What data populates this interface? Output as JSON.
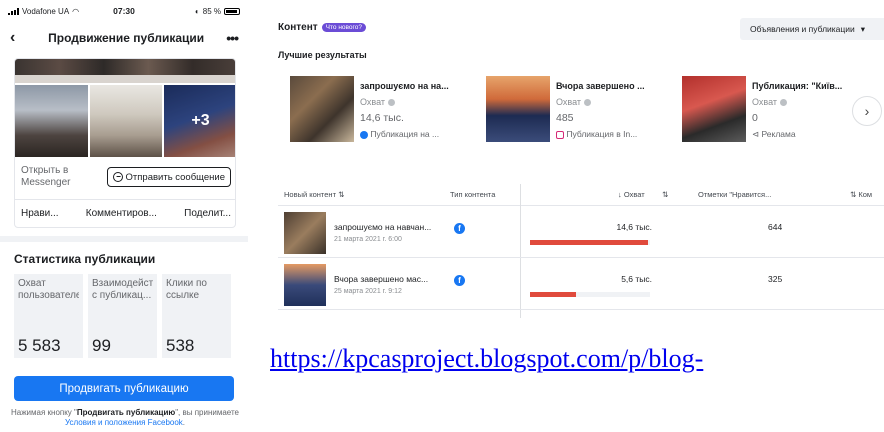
{
  "status_bar": {
    "carrier": "Vodafone UA",
    "time": "07:30",
    "battery": "85 %"
  },
  "phone": {
    "title": "Продвижение публикации",
    "more_label": "•••",
    "photo_more_count": "+3",
    "messenger_text": "Открыть в Messenger",
    "send_message_label": "Отправить сообщение",
    "actions": [
      "Нрави...",
      "Комментиров...",
      "Поделит..."
    ],
    "stats_title": "Статистика публикации",
    "stats": [
      {
        "label": "Охват пользователей",
        "value": "5 583"
      },
      {
        "label": "Взаимодействия с публикац...",
        "value": "99"
      },
      {
        "label": "Клики по ссылке",
        "value": "538"
      }
    ],
    "promote_button": "Продвигать публикацию",
    "terms_prefix": "Нажимая кнопку \"",
    "terms_bold": "Продвигать публикацию",
    "terms_middle": "\", вы принимаете ",
    "terms_link": "Условия и положения Facebook",
    "terms_suffix": "."
  },
  "dashboard": {
    "title": "Контент",
    "new_badge": "Что нового?",
    "dropdown_label": "Объявления и публикации",
    "best_results_label": "Лучшие результаты",
    "best_cards": [
      {
        "name": "запрошуємо на на...",
        "metric": "Охват",
        "value": "14,6 тыс.",
        "source": "Публикация на ...",
        "source_type": "facebook"
      },
      {
        "name": "Вчора завершено ...",
        "metric": "Охват",
        "value": "485",
        "source": "Публикация в In...",
        "source_type": "instagram"
      },
      {
        "name": "Публикация: \"Київ...",
        "metric": "Охват",
        "value": "0",
        "source": "Реклама",
        "source_type": "ad"
      }
    ],
    "table_headers": {
      "content": "Новый контент ⇅",
      "type": "Тип контента",
      "reach": "↓ Охват",
      "reach_sort": "⇅",
      "likes": "Отметки \"Нравится...",
      "comments": "⇅ Ком"
    },
    "rows": [
      {
        "name": "запрошуємо на навчан...",
        "date": "21 марта 2021 г. 6:00",
        "reach": "14,6 тыс.",
        "reach_fraction": 0.98,
        "likes": "644"
      },
      {
        "name": "Вчора завершено мас...",
        "date": "25 марта 2021 г. 9:12",
        "reach": "5,6 тыс.",
        "reach_fraction": 0.38,
        "likes": "325"
      }
    ],
    "bar_color": "#e04a3c",
    "accent_color": "#1877f2"
  },
  "link": {
    "url_text": "https://kpcasproject.blogspot.com/p/blog-"
  }
}
